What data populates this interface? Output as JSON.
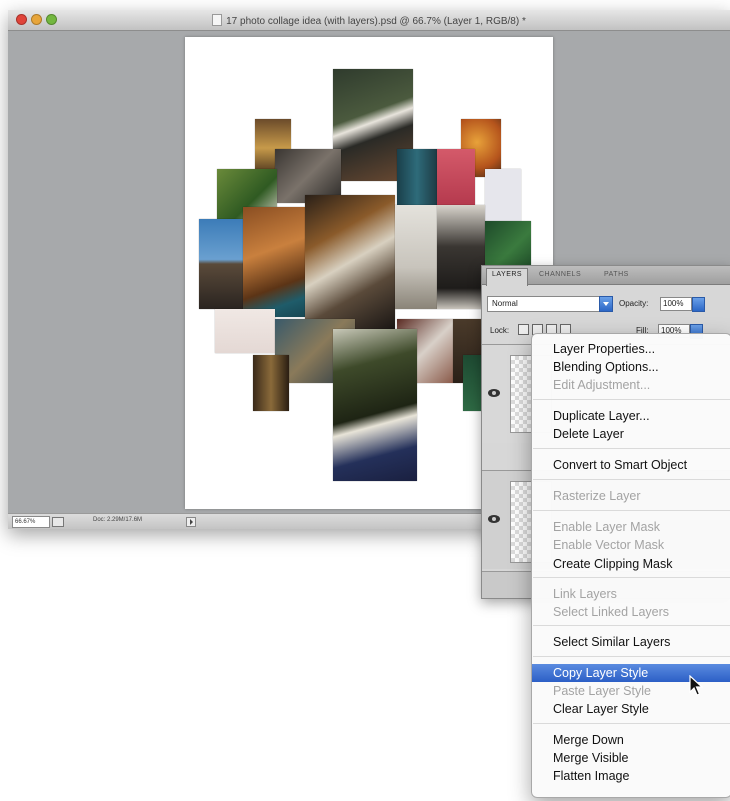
{
  "window": {
    "title": "17 photo collage idea (with layers).psd @ 66.7% (Layer 1, RGB/8) *"
  },
  "statusbar": {
    "zoom": "66.67%",
    "doc_size": "Doc: 2.29M/17.6M"
  },
  "layers_panel": {
    "tabs": [
      "LAYERS",
      "CHANNELS",
      "PATHS"
    ],
    "blend_mode": "Normal",
    "opacity_label": "Opacity:",
    "opacity_value": "100%",
    "lock_label": "Lock:",
    "fill_label": "Fill:",
    "fill_value": "100%"
  },
  "context_menu": {
    "items": [
      {
        "label": "Layer Properties...",
        "state": "enabled"
      },
      {
        "label": "Blending Options...",
        "state": "enabled"
      },
      {
        "label": "Edit Adjustment...",
        "state": "disabled"
      },
      {
        "label": "Duplicate Layer...",
        "state": "enabled"
      },
      {
        "label": "Delete Layer",
        "state": "enabled"
      },
      {
        "label": "Convert to Smart Object",
        "state": "enabled"
      },
      {
        "label": "Rasterize Layer",
        "state": "disabled"
      },
      {
        "label": "Enable Layer Mask",
        "state": "disabled"
      },
      {
        "label": "Enable Vector Mask",
        "state": "disabled"
      },
      {
        "label": "Create Clipping Mask",
        "state": "enabled"
      },
      {
        "label": "Link Layers",
        "state": "disabled"
      },
      {
        "label": "Select Linked Layers",
        "state": "disabled"
      },
      {
        "label": "Select Similar Layers",
        "state": "enabled"
      },
      {
        "label": "Copy Layer Style",
        "state": "highlighted"
      },
      {
        "label": "Paste Layer Style",
        "state": "disabled"
      },
      {
        "label": "Clear Layer Style",
        "state": "enabled"
      },
      {
        "label": "Merge Down",
        "state": "enabled"
      },
      {
        "label": "Merge Visible",
        "state": "enabled"
      },
      {
        "label": "Flatten Image",
        "state": "enabled"
      }
    ]
  },
  "colors": {
    "highlight": "#2c5fc6",
    "workspace": "#a7a9ab",
    "disabled_text": "#a3a3a3"
  }
}
